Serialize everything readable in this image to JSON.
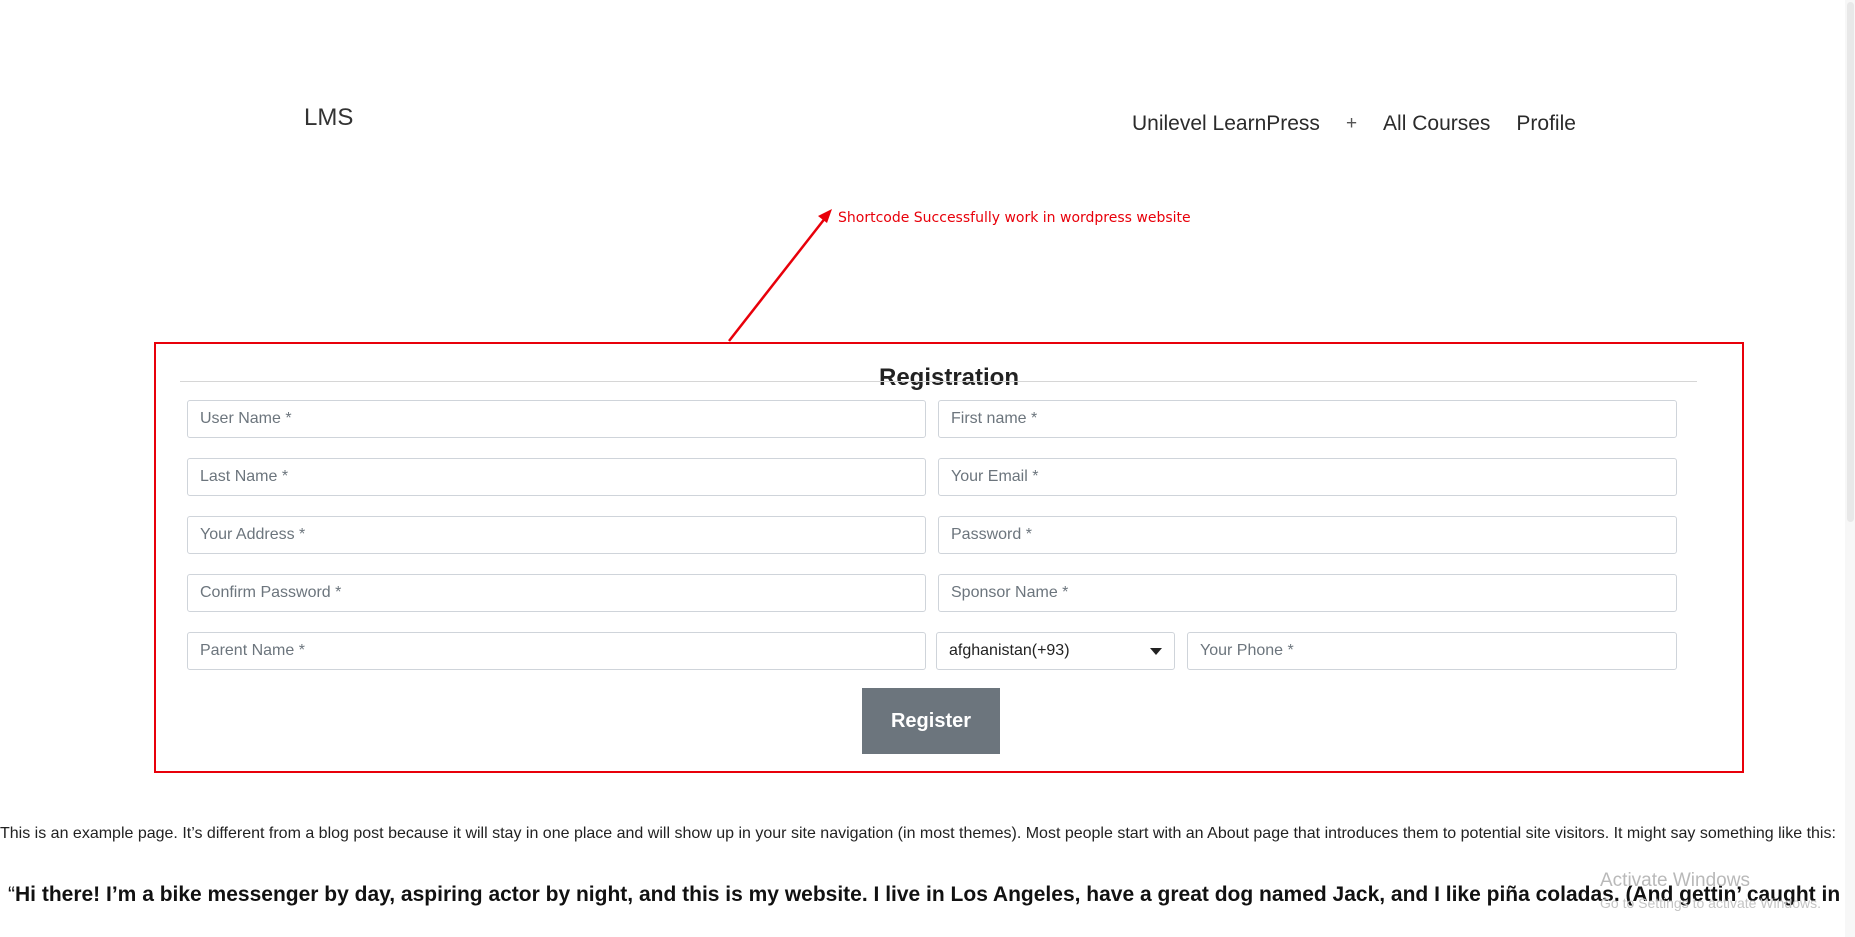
{
  "site": {
    "title": "LMS"
  },
  "nav": {
    "items": [
      {
        "label": "Unilevel LearnPress"
      },
      {
        "label": "+"
      },
      {
        "label": "All Courses"
      },
      {
        "label": "Profile"
      }
    ]
  },
  "annotation": {
    "text": "Shortcode Successfully work in wordpress website",
    "color": "#e8000a"
  },
  "registration": {
    "title": "Registration",
    "fields": {
      "user_name": "User Name *",
      "first_name": "First name *",
      "last_name": "Last Name *",
      "email": "Your Email *",
      "address": "Your Address *",
      "password": "Password *",
      "confirm_password": "Confirm Password *",
      "sponsor_name": "Sponsor Name *",
      "parent_name": "Parent Name *",
      "phone": "Your Phone *"
    },
    "country_select": {
      "selected": "afghanistan(+93)"
    },
    "register_label": "Register",
    "button_color": "#6c757d"
  },
  "content": {
    "paragraph": "This is an example page. It’s different from a blog post because it will stay in one place and will show up in your site navigation (in most themes). Most people start with an About page that introduces them to potential site visitors. It might say something like this:",
    "quote_mark": "“",
    "quote": "Hi there! I’m a bike messenger by day, aspiring actor by night, and this is my website. I live in Los Angeles, have a great dog named Jack, and I like piña coladas. (And gettin’ caught in the rain.)"
  },
  "watermark": {
    "title": "Activate Windows",
    "subtitle": "Go to Settings to activate Windows."
  }
}
